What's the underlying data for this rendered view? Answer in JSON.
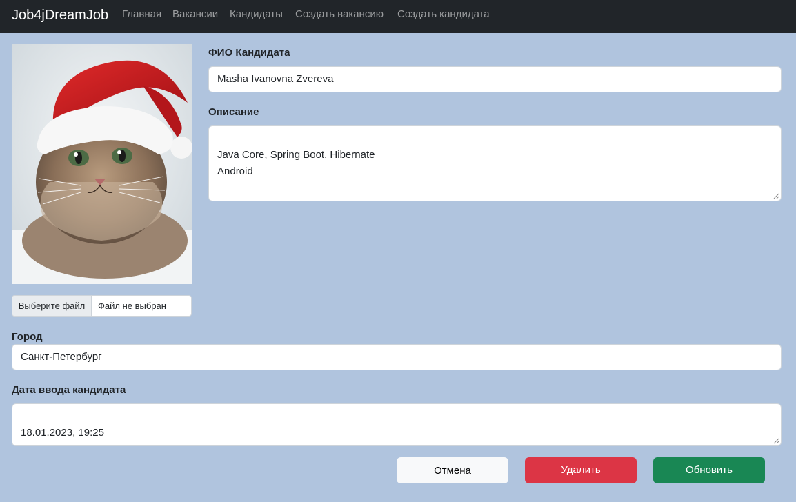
{
  "navbar": {
    "brand": "Job4jDreamJob",
    "links": [
      "Главная",
      "Вакансии",
      "Кандидаты",
      "Создать вакансию",
      "Создать кандидата"
    ]
  },
  "photo": {
    "alt": "cat-in-santa-hat"
  },
  "file_input": {
    "button_label": "Выберите файл",
    "status": "Файл не выбран"
  },
  "form": {
    "name_label": "ФИО Кандидата",
    "name_value": "Masha Ivanovna Zvereva",
    "description_label": "Описание",
    "description_value": "Java Core, Spring Boot, Hibernate\nAndroid",
    "city_label": "Город",
    "city_value": "Санкт-Петербург",
    "date_label": "Дата ввода кандидата",
    "date_value": "18.01.2023, 19:25"
  },
  "actions": {
    "cancel_label": "Отмена",
    "delete_label": "Удалить",
    "update_label": "Обновить"
  },
  "colors": {
    "page_background": "#b0c4de",
    "navbar": "#212529",
    "delete": "#dc3545",
    "update": "#198754"
  }
}
